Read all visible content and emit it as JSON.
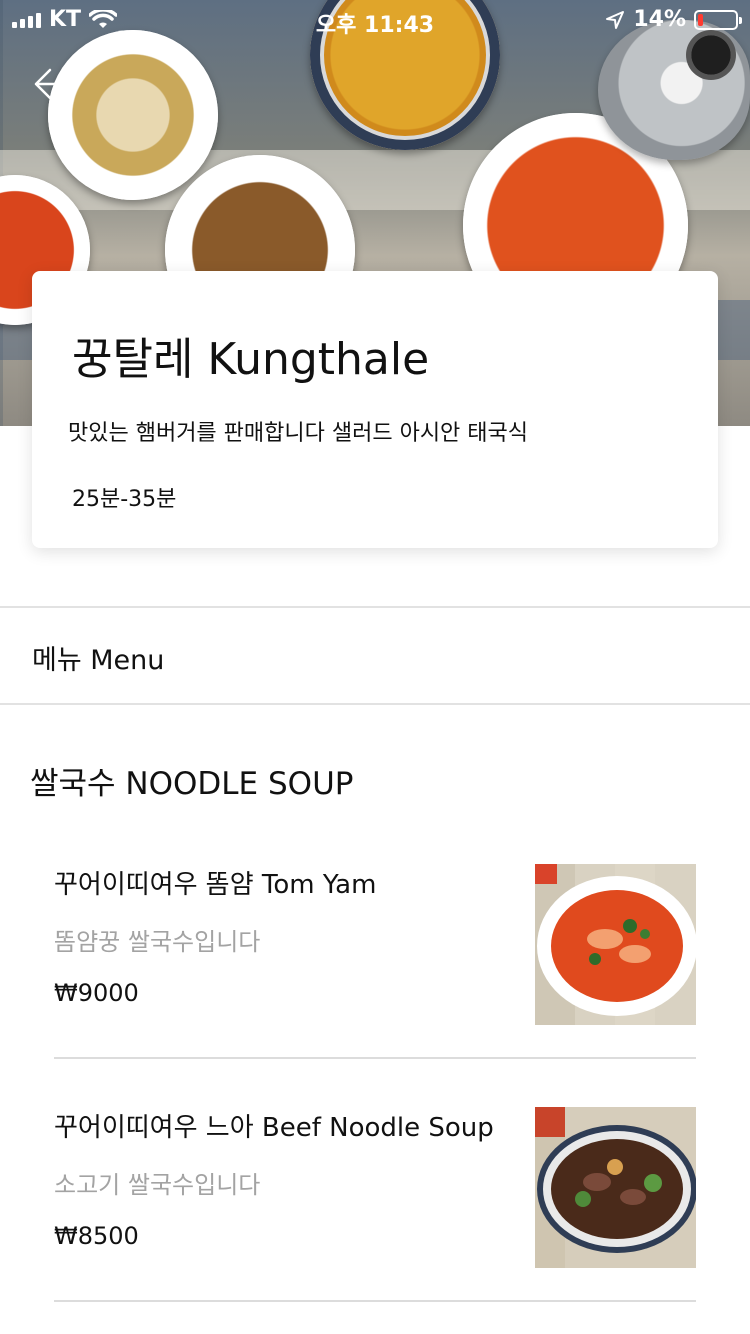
{
  "status_bar": {
    "carrier": "KT",
    "time": "오후 11:43",
    "battery": "14%",
    "battery_level": 0.14
  },
  "restaurant": {
    "name": "꿍탈레 Kungthale",
    "description": "맛있는 햄버거를 판매합니다 샐러드 아시안 태국식",
    "delivery_time": "25분-35분"
  },
  "tabs": {
    "menu": "메뉴 Menu"
  },
  "categories": [
    {
      "title": "쌀국수 NOODLE SOUP",
      "items": [
        {
          "name": "꾸어이띠여우 똠얌 Tom Yam",
          "description": "똠얌꿍 쌀국수입니다",
          "price": "₩9000"
        },
        {
          "name": "꾸어이띠여우 느아 Beef Noodle Soup",
          "description": "소고기 쌀국수입니다",
          "price": "₩8500"
        }
      ]
    }
  ],
  "colors": {
    "battery_low": "#ff3b30",
    "secondary_text": "#a3a3a3",
    "divider": "#e2e2e2"
  }
}
